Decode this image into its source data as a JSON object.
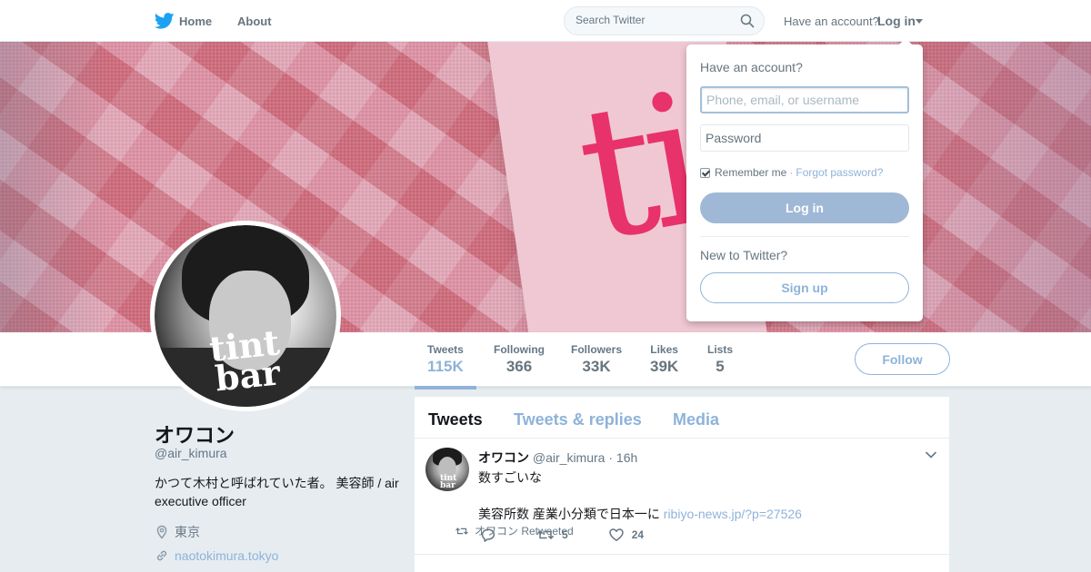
{
  "topnav": {
    "home_label": "Home",
    "about_label": "About",
    "search_placeholder": "Search Twitter",
    "have_account": "Have an account?",
    "login_label": "Log in"
  },
  "profile": {
    "name": "オワコン",
    "handle": "@air_kimura",
    "bio": "かつて木村と呼ばれていた者。 美容師 / air executive officer",
    "location": "東京",
    "url": "naotokimura.tokyo",
    "avatar_brand_line1": "tint",
    "avatar_brand_line2": "bar"
  },
  "banner": {
    "text": "ti"
  },
  "stats": [
    {
      "label": "Tweets",
      "value": "115K",
      "active": true
    },
    {
      "label": "Following",
      "value": "366",
      "active": false
    },
    {
      "label": "Followers",
      "value": "33K",
      "active": false
    },
    {
      "label": "Likes",
      "value": "39K",
      "active": false
    },
    {
      "label": "Lists",
      "value": "5",
      "active": false
    }
  ],
  "follow_label": "Follow",
  "timeline": {
    "tabs": [
      "Tweets",
      "Tweets & replies",
      "Media"
    ],
    "tweet": {
      "name": "オワコン",
      "handle": "@air_kimura",
      "time": "16h",
      "line1": "数すごいな",
      "line2": "美容所数 産業小分類で日本一に",
      "link": "ribiyo-news.jp/?p=27526",
      "retweets": "5",
      "likes": "24"
    },
    "next_retweeted": "オワコン Retweeted"
  },
  "login_dropdown": {
    "title": "Have an account?",
    "username_placeholder": "Phone, email, or username",
    "password_placeholder": "Password",
    "remember_label": "Remember me",
    "separator": "·",
    "forgot_label": "Forgot password?",
    "login_button": "Log in",
    "new_label": "New to Twitter?",
    "signup_button": "Sign up"
  },
  "colors": {
    "accent": "#8eb3d9",
    "twitter_blue": "#1da1f2",
    "muted_text": "#657786",
    "banner_pink": "#e8326b"
  },
  "icons": {
    "logo": "twitter-bird-icon",
    "search": "search-icon",
    "location": "location-pin-icon",
    "link": "link-icon",
    "reply": "reply-icon",
    "retweet": "retweet-icon",
    "like": "heart-icon",
    "more": "chevron-down-icon"
  }
}
